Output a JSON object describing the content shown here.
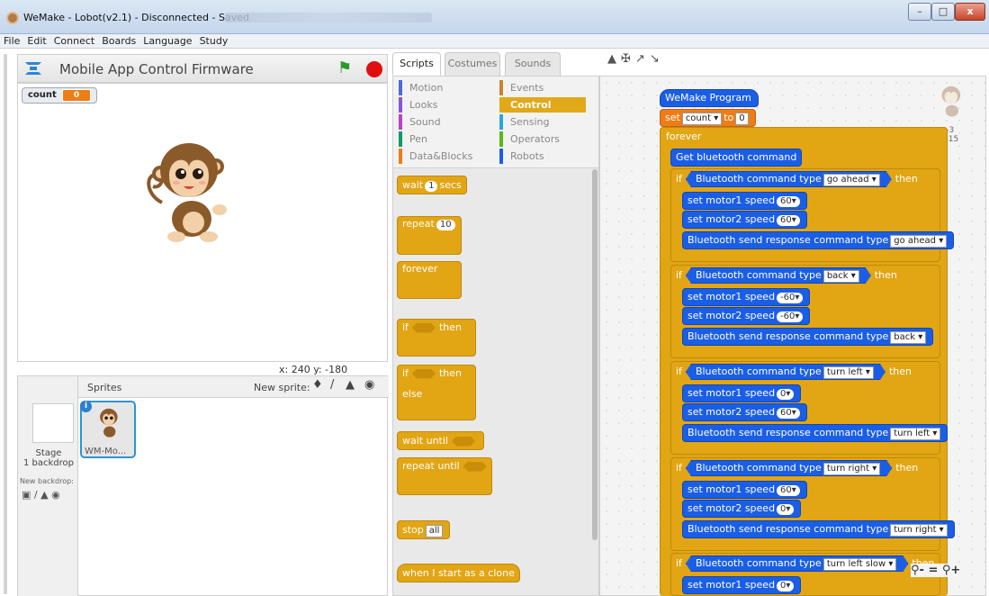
{
  "window": {
    "title": "WeMake - Lobot(v2.1) - Disconnected - Saved"
  },
  "menu": [
    "File",
    "Edit",
    "Connect",
    "Boards",
    "Language",
    "Study"
  ],
  "stage": {
    "project_title": "Mobile App Control Firmware",
    "monitor_label": "count",
    "monitor_value": "0",
    "coords": "x: 240  y: -180"
  },
  "sprites": {
    "label": "Sprites",
    "new_sprite_label": "New sprite:",
    "stage_name": "Stage",
    "stage_backdrops": "1 backdrop",
    "new_backdrop_label": "New backdrop:",
    "sprite_name": "WM-Mo..."
  },
  "tabs": {
    "scripts": "Scripts",
    "costumes": "Costumes",
    "sounds": "Sounds"
  },
  "categories": {
    "left": [
      {
        "label": "Motion",
        "color": "#4a6cd4"
      },
      {
        "label": "Looks",
        "color": "#8a55d7"
      },
      {
        "label": "Sound",
        "color": "#bb42c3"
      },
      {
        "label": "Pen",
        "color": "#0e9a6c"
      },
      {
        "label": "Data&Blocks",
        "color": "#ee7d16"
      }
    ],
    "right": [
      {
        "label": "Events",
        "color": "#c88330"
      },
      {
        "label": "Control",
        "color": "#e1a91a"
      },
      {
        "label": "Sensing",
        "color": "#2ca5e2"
      },
      {
        "label": "Operators",
        "color": "#5cb712"
      },
      {
        "label": "Robots",
        "color": "#1b5ee6"
      }
    ]
  },
  "palette": {
    "wait": "wait",
    "wait_num": "1",
    "secs": "secs",
    "repeat": "repeat",
    "repeat_num": "10",
    "forever": "forever",
    "if": "if",
    "then": "then",
    "else": "else",
    "wait_until": "wait until",
    "repeat_until": "repeat until",
    "stop": "stop",
    "stop_opt": "all",
    "clone": "when I start as a clone"
  },
  "script": {
    "hat": "WeMake Program",
    "set": "set",
    "var": "count",
    "to": "to",
    "set_val": "0",
    "forever": "forever",
    "get_bt": "Get bluetooth command",
    "if": "if",
    "then": "then",
    "bt_type": "Bluetooth command type",
    "m1": "set motor1 speed",
    "m2": "set motor2 speed",
    "resp": "Bluetooth send response command type",
    "groups": [
      {
        "cmd": "go ahead",
        "s1": "60",
        "s2": "60"
      },
      {
        "cmd": "back",
        "s1": "-60",
        "s2": "-60"
      },
      {
        "cmd": "turn left",
        "s1": "0",
        "s2": "60"
      },
      {
        "cmd": "turn right",
        "s1": "60",
        "s2": "0"
      },
      {
        "cmd": "turn left slow",
        "s1": "0"
      }
    ],
    "sprite_x": "x: -3",
    "sprite_y": "y: -15"
  }
}
